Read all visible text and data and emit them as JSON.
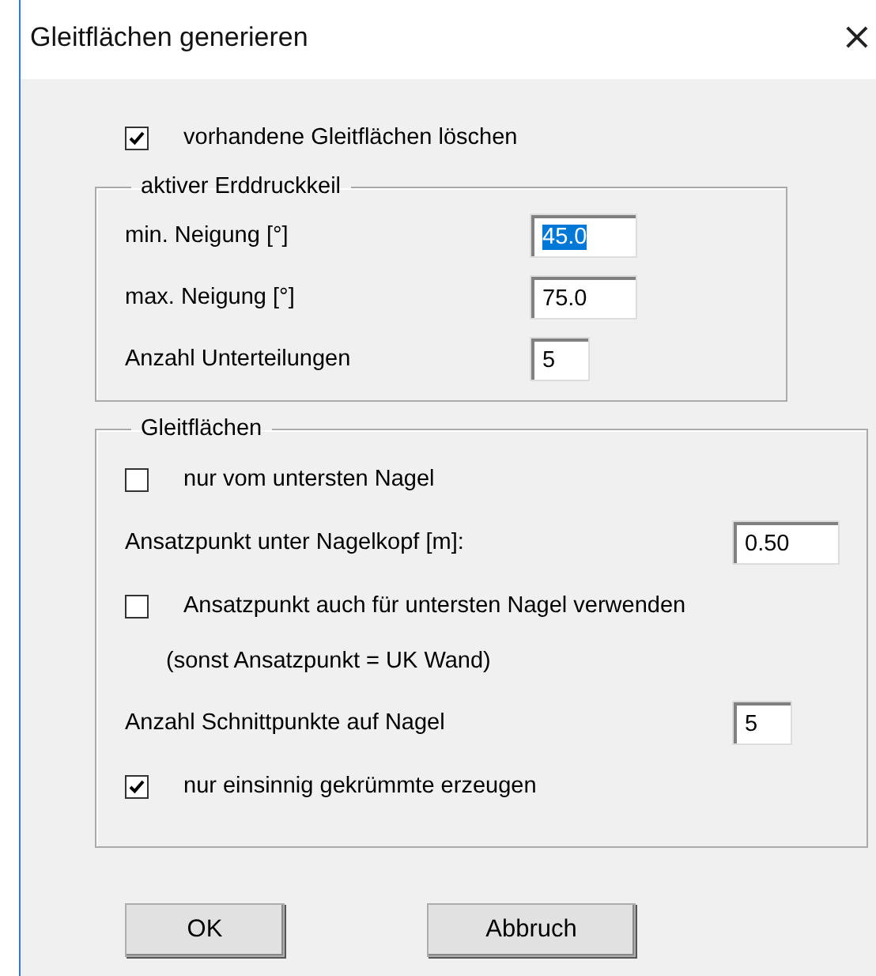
{
  "window": {
    "title": "Gleitflächen generieren",
    "close": "×"
  },
  "delete_existing": {
    "label": "vorhandene Gleitflächen löschen",
    "checked": true
  },
  "wedge_group": {
    "title": "aktiver Erddruckkeil",
    "rows": [
      {
        "label": "min. Neigung [°]",
        "value": "45.0",
        "selected": true
      },
      {
        "label": "max. Neigung [°]",
        "value": "75.0",
        "selected": false
      },
      {
        "label": "Anzahl Unterteilungen",
        "value": "5",
        "selected": false
      }
    ]
  },
  "slip_group": {
    "title": "Gleitflächen",
    "items": [
      {
        "kind": "checkbox",
        "label": "nur vom untersten Nagel",
        "checked": false
      },
      {
        "kind": "field",
        "label": "Ansatzpunkt unter Nagelkopf [m]:",
        "value": "0.50"
      },
      {
        "kind": "checkbox",
        "label": "Ansatzpunkt auch für untersten Nagel verwenden",
        "checked": false
      },
      {
        "kind": "note",
        "label": "(sonst Ansatzpunkt = UK Wand)"
      },
      {
        "kind": "field",
        "label": "Anzahl Schnittpunkte auf Nagel",
        "value": "5"
      },
      {
        "kind": "checkbox",
        "label": "nur einsinnig gekrümmte erzeugen",
        "checked": true
      }
    ]
  },
  "buttons": [
    "OK",
    "Abbruch"
  ]
}
